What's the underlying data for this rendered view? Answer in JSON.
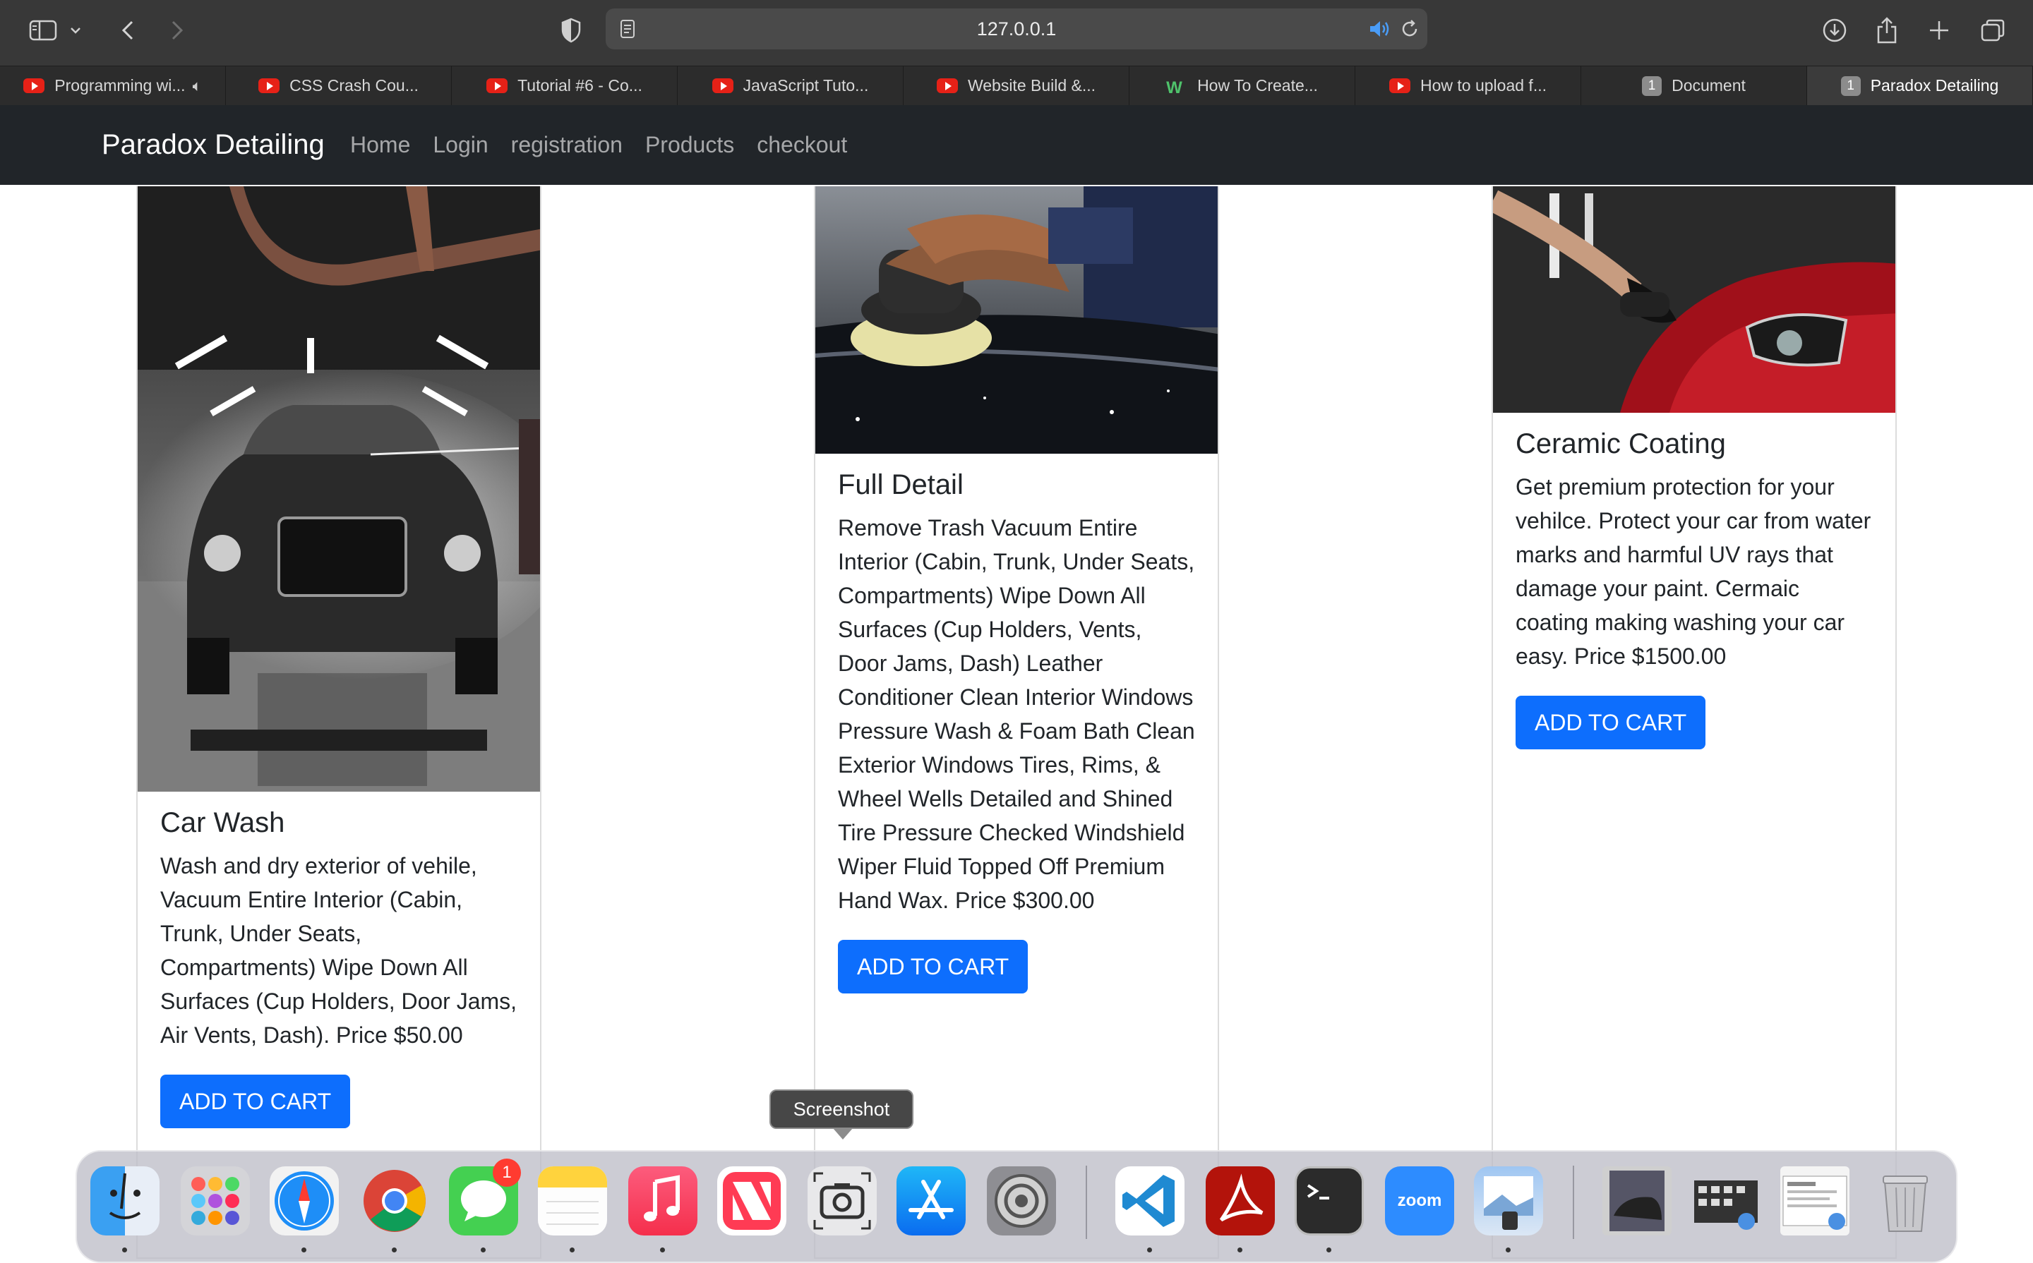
{
  "browser": {
    "url": "127.0.0.1",
    "tabs": [
      {
        "label": "Programming wi...",
        "favicon": "youtube-icon"
      },
      {
        "label": "CSS Crash Cou...",
        "favicon": "youtube-icon"
      },
      {
        "label": "Tutorial #6 - Co...",
        "favicon": "youtube-icon"
      },
      {
        "label": "JavaScript Tuto...",
        "favicon": "youtube-icon"
      },
      {
        "label": "Website Build &...",
        "favicon": "youtube-icon"
      },
      {
        "label": "How To Create...",
        "favicon": "w3-icon"
      },
      {
        "label": "How to upload f...",
        "favicon": "youtube-icon"
      },
      {
        "label": "Document",
        "favicon": "1"
      },
      {
        "label": "Paradox Detailing",
        "favicon": "1"
      }
    ]
  },
  "nav": {
    "brand": "Paradox Detailing",
    "links": [
      "Home",
      "Login",
      "registration",
      "Products",
      "checkout"
    ]
  },
  "products": [
    {
      "title": "Car Wash",
      "description": "Wash and dry exterior of vehile, Vacuum Entire Interior (Cabin, Trunk, Under Seats, Compartments) Wipe Down All Surfaces (Cup Holders, Door Jams, Air Vents, Dash). Price $50.00",
      "button": "ADD TO CART"
    },
    {
      "title": "Full Detail",
      "description": "Remove Trash Vacuum Entire Interior (Cabin, Trunk, Under Seats, Compartments) Wipe Down All Surfaces (Cup Holders, Vents, Door Jams, Dash) Leather Conditioner Clean Interior Windows Pressure Wash & Foam Bath Clean Exterior Windows Tires, Rims, & Wheel Wells Detailed and Shined Tire Pressure Checked Windshield Wiper Fluid Topped Off Premium Hand Wax. Price $300.00",
      "button": "ADD TO CART"
    },
    {
      "title": "Ceramic Coating",
      "description": "Get premium protection for your vehilce. Protect your car from water marks and harmful UV rays that damage your paint. Cermaic coating making washing your car easy. Price $1500.00",
      "button": "ADD TO CART"
    }
  ],
  "tooltip": "Screenshot",
  "dock": {
    "apps": [
      "finder",
      "launchpad",
      "safari",
      "chrome",
      "messages",
      "notes",
      "music",
      "news",
      "screenshot",
      "app-store",
      "system-settings",
      "vscode",
      "acrobat",
      "terminal",
      "zoom",
      "preview"
    ],
    "zoom_label": "zoom",
    "messages_badge": "1"
  }
}
